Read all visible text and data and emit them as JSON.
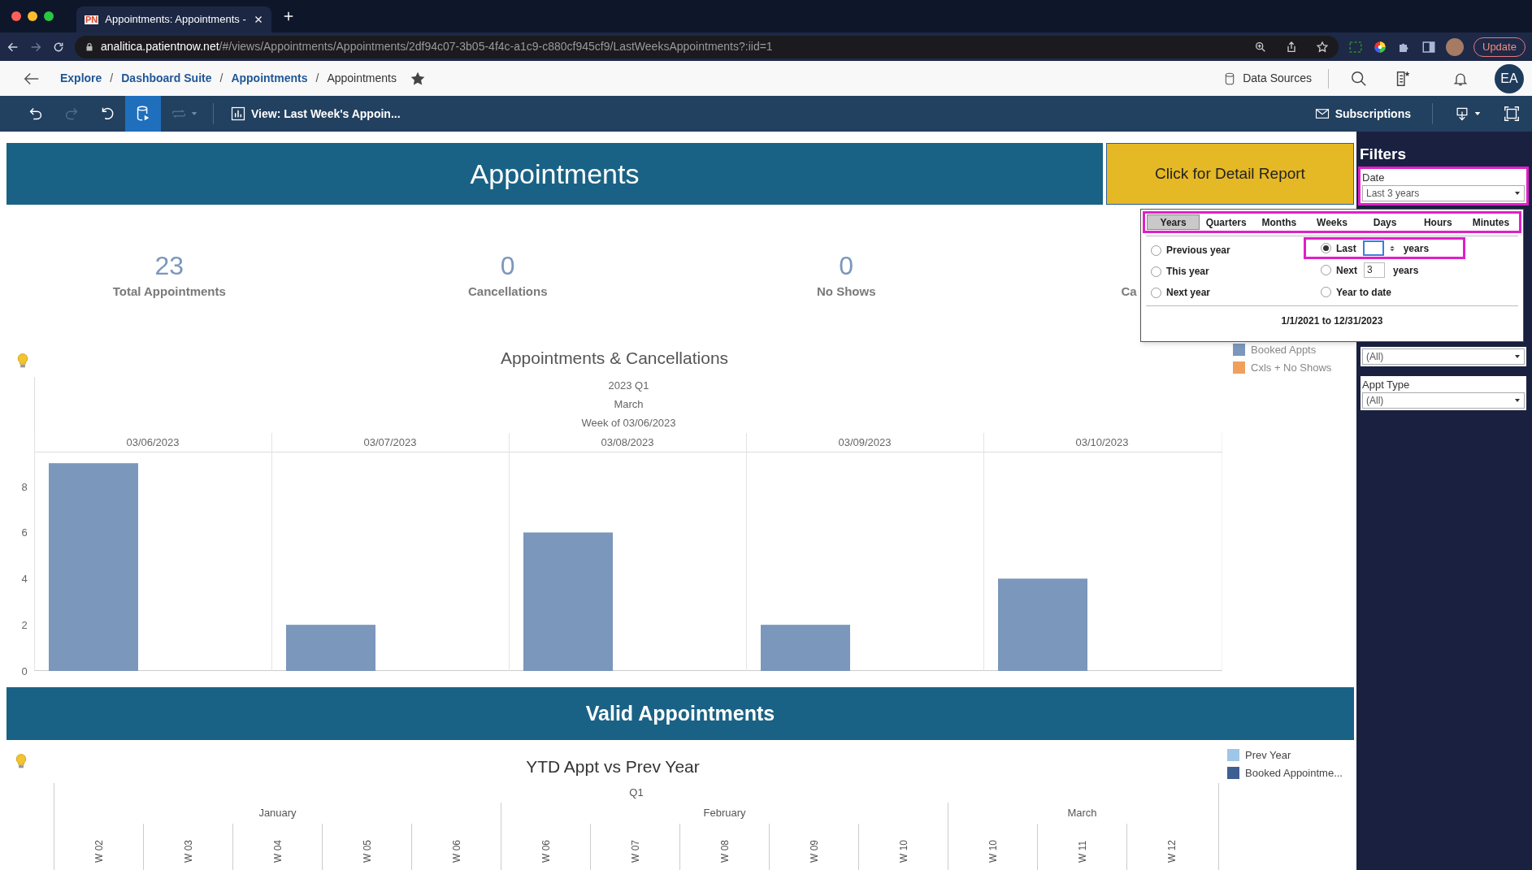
{
  "browser": {
    "tab": {
      "favicon": "PN",
      "title": "Appointments: Appointments -",
      "selected": true
    },
    "url_domain": "analitica.patientnow.net",
    "url_path": "/#/views/Appointments/Appointments/2df94c07-3b05-4f4c-a1c9-c880cf945cf9/LastWeeksAppointments?:iid=1",
    "update_button": "Update"
  },
  "header": {
    "breadcrumbs": [
      {
        "label": "Explore",
        "link": true,
        "separator": "/"
      },
      {
        "label": "Dashboard Suite",
        "link": true,
        "separator": "/"
      },
      {
        "label": "Appointments",
        "link": true,
        "separator": "/"
      },
      {
        "label": "Appointments",
        "link": false
      }
    ],
    "data_sources": "Data Sources",
    "avatar": "EA"
  },
  "toolbar": {
    "tools": [
      {
        "kind": "undo",
        "disabled": false,
        "pressed": false
      },
      {
        "kind": "redo",
        "disabled": true,
        "pressed": false
      },
      {
        "kind": "revert",
        "disabled": false,
        "pressed": false
      },
      {
        "kind": "data-source",
        "disabled": false,
        "pressed": true
      },
      {
        "kind": "refresh",
        "disabled": true,
        "pressed": false
      }
    ],
    "view": "View: Last Week's Appoin...",
    "subscriptions": "Subscriptions"
  },
  "dashboard": {
    "title": "Appointments",
    "detail_button": "Click for Detail Report",
    "kpis": [
      {
        "value": "23",
        "label": "Total Appointments"
      },
      {
        "value": "0",
        "label": "Cancellations"
      },
      {
        "value": "0",
        "label": "No Shows"
      },
      {
        "label": "Ca"
      }
    ],
    "chart1": {
      "title": "Appointments & Cancellations",
      "header": [
        "2023 Q1",
        "March",
        "Week of 03/06/2023"
      ],
      "chart_data": {
        "type": "bar",
        "categories": [
          "03/06/2023",
          "03/07/2023",
          "03/08/2023",
          "03/09/2023",
          "03/10/2023"
        ],
        "series": [
          {
            "name": "Booked Appts",
            "color": "#7b97bb",
            "values": [
              9,
              2,
              6,
              2,
              4
            ]
          },
          {
            "name": "Cxls + No Shows",
            "color": "#f0a05c",
            "values": [
              0,
              0,
              0,
              0,
              0
            ]
          }
        ],
        "ylim": [
          0,
          9.5
        ],
        "yticks": [
          0,
          2,
          4,
          6,
          8
        ]
      }
    },
    "section2_title": "Valid Appointments",
    "chart2": {
      "title": "YTD Appt vs Prev Year",
      "legend": [
        {
          "label": "Prev Year",
          "color": "#9fc6e8"
        },
        {
          "label": "Booked Appointme...",
          "color": "#3e5f92"
        }
      ],
      "quarter": "Q1",
      "months": [
        {
          "label": "January",
          "weeks": [
            "W 02",
            "W 03",
            "W 04",
            "W 05",
            "W 06"
          ]
        },
        {
          "label": "February",
          "weeks": [
            "W 06",
            "W 07",
            "W 08",
            "W 09",
            "W 10"
          ]
        },
        {
          "label": "March",
          "weeks": [
            "W 10",
            "W 11",
            "W 12"
          ]
        }
      ]
    }
  },
  "filters": {
    "title": "Filters",
    "items": [
      {
        "label": "Date",
        "value": "Last 3 years",
        "highlighted": true
      },
      {
        "value": "(All)",
        "highlighted": false
      },
      {
        "label": "Appt Type",
        "value": "(All)",
        "highlighted": false
      }
    ]
  },
  "date_popup": {
    "tabs_highlighted": true,
    "tabs": [
      {
        "label": "Years",
        "selected": true
      },
      {
        "label": "Quarters",
        "selected": false
      },
      {
        "label": "Months",
        "selected": false
      },
      {
        "label": "Weeks",
        "selected": false
      },
      {
        "label": "Days",
        "selected": false
      },
      {
        "label": "Hours",
        "selected": false
      },
      {
        "label": "Minutes",
        "selected": false
      }
    ],
    "options_left": [
      {
        "label": "Previous year",
        "selected": false
      },
      {
        "label": "This year",
        "selected": false
      },
      {
        "label": "Next year",
        "selected": false
      }
    ],
    "options_right": [
      {
        "kind": "count",
        "label": "Last",
        "unit": "years",
        "selected": true,
        "highlighted": true,
        "focused": true
      },
      {
        "kind": "count",
        "label": "Next",
        "value": "3",
        "unit": "years",
        "selected": false,
        "highlighted": false,
        "focused": false
      },
      {
        "kind": "plain",
        "label": "Year to date",
        "selected": false,
        "highlighted": false
      }
    ],
    "range": "1/1/2021 to 12/31/2023"
  }
}
